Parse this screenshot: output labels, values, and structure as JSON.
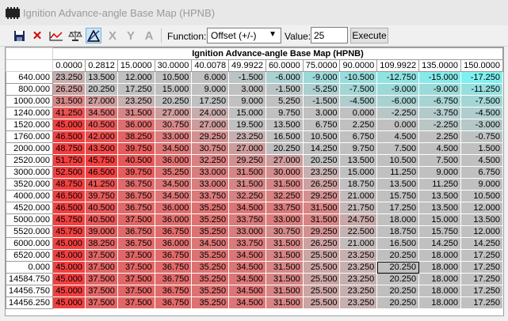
{
  "window": {
    "title": "Ignition Advance-angle Base Map (HPNB)"
  },
  "toolbar": {
    "function_label": "Function:",
    "function_value": "Offset (+/-)",
    "value_label": "Value:",
    "value_input": "25",
    "execute_label": "Execute",
    "icons": [
      "save-icon",
      "close-icon",
      "graph-icon",
      "balance-icon",
      "triangle-icon",
      "x-axis-icon",
      "y-axis-icon",
      "font-icon"
    ]
  },
  "colors": {
    "low": "#00ffff",
    "mid": "#c0c0c0",
    "high": "#f04040"
  },
  "map": {
    "title": "Ignition Advance-angle Base Map (HPNB)",
    "columns": [
      "0.0000",
      "0.2812",
      "15.0000",
      "30.0000",
      "40.0078",
      "49.9922",
      "60.0000",
      "75.0000",
      "90.0000",
      "109.9922",
      "135.0000",
      "150.0000"
    ],
    "rows": [
      {
        "label": "640.000",
        "values": [
          "23.250",
          "13.500",
          "12.000",
          "10.500",
          "6.000",
          "-1.500",
          "-6.000",
          "-9.000",
          "-10.500",
          "-12.750",
          "-15.000",
          "-17.250"
        ]
      },
      {
        "label": "800.000",
        "values": [
          "26.250",
          "20.250",
          "17.250",
          "15.000",
          "9.000",
          "3.000",
          "-1.500",
          "-5.250",
          "-7.500",
          "-9.000",
          "-9.000",
          "-11.250"
        ]
      },
      {
        "label": "1000.000",
        "values": [
          "31.500",
          "27.000",
          "23.250",
          "20.250",
          "17.250",
          "9.000",
          "5.250",
          "-1.500",
          "-4.500",
          "-6.000",
          "-6.750",
          "-7.500"
        ]
      },
      {
        "label": "1240.000",
        "values": [
          "41.250",
          "34.500",
          "31.500",
          "27.000",
          "24.000",
          "15.000",
          "9.750",
          "3.000",
          "0.000",
          "-2.250",
          "-3.750",
          "-4.500"
        ]
      },
      {
        "label": "1520.000",
        "values": [
          "45.000",
          "40.500",
          "36.000",
          "30.750",
          "27.000",
          "19.500",
          "13.500",
          "6.750",
          "2.250",
          "0.000",
          "-2.250",
          "-3.000"
        ]
      },
      {
        "label": "1760.000",
        "values": [
          "46.500",
          "42.000",
          "38.250",
          "33.000",
          "29.250",
          "23.250",
          "16.500",
          "10.500",
          "6.750",
          "4.500",
          "2.250",
          "-0.750"
        ]
      },
      {
        "label": "2000.000",
        "values": [
          "48.750",
          "43.500",
          "39.750",
          "34.500",
          "30.750",
          "27.000",
          "20.250",
          "14.250",
          "9.750",
          "7.500",
          "4.500",
          "1.500"
        ]
      },
      {
        "label": "2520.000",
        "values": [
          "51.750",
          "45.750",
          "40.500",
          "36.000",
          "32.250",
          "29.250",
          "27.000",
          "20.250",
          "13.500",
          "10.500",
          "7.500",
          "4.500"
        ]
      },
      {
        "label": "3000.000",
        "values": [
          "52.500",
          "46.500",
          "39.750",
          "35.250",
          "33.000",
          "31.500",
          "30.000",
          "23.250",
          "15.000",
          "11.250",
          "9.000",
          "6.750"
        ]
      },
      {
        "label": "3520.000",
        "values": [
          "48.750",
          "41.250",
          "36.750",
          "34.500",
          "33.000",
          "31.500",
          "31.500",
          "26.250",
          "18.750",
          "13.500",
          "11.250",
          "9.000"
        ]
      },
      {
        "label": "4000.000",
        "values": [
          "46.500",
          "39.750",
          "36.750",
          "34.500",
          "33.750",
          "32.250",
          "32.250",
          "29.250",
          "21.000",
          "15.750",
          "13.500",
          "10.500"
        ]
      },
      {
        "label": "4520.000",
        "values": [
          "46.500",
          "40.500",
          "36.750",
          "36.000",
          "35.250",
          "34.500",
          "33.750",
          "31.500",
          "21.750",
          "17.250",
          "13.500",
          "12.000"
        ]
      },
      {
        "label": "5000.000",
        "values": [
          "45.750",
          "40.500",
          "37.500",
          "36.000",
          "35.250",
          "33.750",
          "33.000",
          "31.500",
          "24.750",
          "18.000",
          "15.000",
          "13.500"
        ]
      },
      {
        "label": "5520.000",
        "values": [
          "45.750",
          "39.000",
          "36.750",
          "36.750",
          "35.250",
          "33.000",
          "30.750",
          "29.250",
          "22.500",
          "18.750",
          "15.750",
          "12.000"
        ]
      },
      {
        "label": "6000.000",
        "values": [
          "45.000",
          "38.250",
          "36.750",
          "36.000",
          "34.500",
          "33.750",
          "31.500",
          "26.250",
          "21.000",
          "16.500",
          "14.250",
          "14.250"
        ]
      },
      {
        "label": "6520.000",
        "values": [
          "45.000",
          "37.500",
          "37.500",
          "36.750",
          "35.250",
          "34.500",
          "31.500",
          "25.500",
          "23.250",
          "20.250",
          "18.000",
          "17.250"
        ]
      },
      {
        "label": "0.000",
        "values": [
          "45.000",
          "37.500",
          "37.500",
          "36.750",
          "35.250",
          "34.500",
          "31.500",
          "25.500",
          "23.250",
          "20.250",
          "18.000",
          "17.250"
        ]
      },
      {
        "label": "14584.750",
        "values": [
          "45.000",
          "37.500",
          "37.500",
          "36.750",
          "35.250",
          "34.500",
          "31.500",
          "25.500",
          "23.250",
          "20.250",
          "18.000",
          "17.250"
        ]
      },
      {
        "label": "14456.750",
        "values": [
          "45.000",
          "37.500",
          "37.500",
          "36.750",
          "35.250",
          "34.500",
          "31.500",
          "25.500",
          "23.250",
          "20.250",
          "18.000",
          "17.250"
        ]
      },
      {
        "label": "14456.250",
        "values": [
          "45.000",
          "37.500",
          "37.500",
          "36.750",
          "35.250",
          "34.500",
          "31.500",
          "25.500",
          "23.250",
          "20.250",
          "18.000",
          "17.250"
        ]
      }
    ]
  }
}
